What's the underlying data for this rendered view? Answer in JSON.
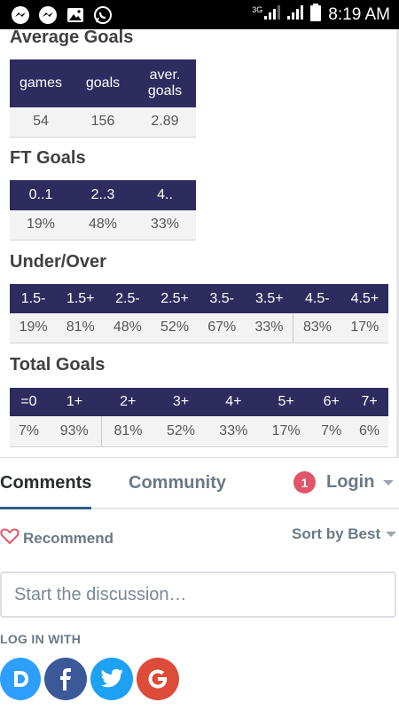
{
  "status_bar": {
    "network_label": "3G",
    "time": "8:19 AM"
  },
  "average_goals": {
    "title": "Average Goals",
    "headers": [
      "games",
      "goals",
      "aver. goals"
    ],
    "values": [
      "54",
      "156",
      "2.89"
    ]
  },
  "ft_goals": {
    "title": "FT Goals",
    "headers": [
      "0..1",
      "2..3",
      "4.."
    ],
    "values": [
      "19%",
      "48%",
      "33%"
    ]
  },
  "under_over": {
    "title": "Under/Over",
    "headers": [
      "1.5-",
      "1.5+",
      "2.5-",
      "2.5+",
      "3.5-",
      "3.5+",
      "4.5-",
      "4.5+"
    ],
    "values": [
      "19%",
      "81%",
      "48%",
      "52%",
      "67%",
      "33%",
      "83%",
      "17%"
    ]
  },
  "total_goals": {
    "title": "Total Goals",
    "headers": [
      "=0",
      "1+",
      "2+",
      "3+",
      "4+",
      "5+",
      "6+",
      "7+"
    ],
    "values": [
      "7%",
      "93%",
      "81%",
      "52%",
      "33%",
      "17%",
      "7%",
      "6%"
    ]
  },
  "comments": {
    "tab_comments": "Comments",
    "tab_community": "Community",
    "notification_count": "1",
    "login_label": "Login",
    "recommend_label": "Recommend",
    "sort_label": "Sort by Best",
    "discussion_placeholder": "Start the discussion…",
    "login_with_label": "LOG IN WITH",
    "social_providers": [
      "disqus-icon",
      "facebook-icon",
      "twitter-icon",
      "google-icon"
    ]
  },
  "colors": {
    "table_header_bg": "#2e2c5e",
    "table_cell_bg": "#f3f3f3",
    "notification_badge": "#e05569",
    "disqus": "#2e9fff",
    "facebook": "#3b5998",
    "twitter": "#1da1f2",
    "google": "#dd4b39"
  }
}
